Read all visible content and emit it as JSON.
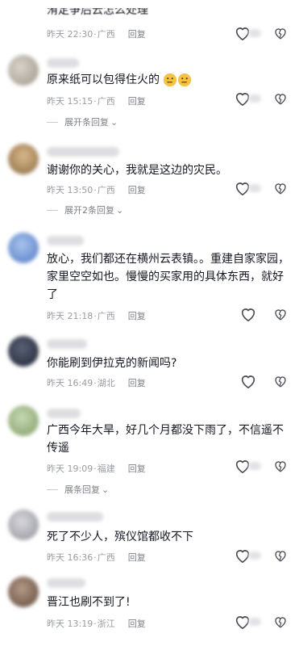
{
  "comments": [
    {
      "text": "洧定争后云怎么处理",
      "date": "昨天 22:30",
      "region": "广西",
      "reply": "回复"
    },
    {
      "text": "原来纸可以包得住火的",
      "date": "昨天 15:15",
      "region": "广西",
      "reply": "回复",
      "expand": "展开条回复"
    },
    {
      "text": "谢谢你的关心，我就是这边的灾民。",
      "date": "昨天 13:50",
      "region": "广西",
      "reply": "回复",
      "expand": "展开2条回复"
    },
    {
      "text": "放心，我们都还在横州云表镇。。重建自家家园，家里空空如也。慢慢的买家用的具体东西，就好了",
      "date": "昨天 21:18",
      "region": "广西",
      "reply": "回复"
    },
    {
      "text": "你能刷到伊拉克的新闻吗?",
      "date": "昨天 16:49",
      "region": "湖北",
      "reply": "回复"
    },
    {
      "text": "广西今年大旱，好几个月都没下雨了，不信遥不传遥",
      "date": "昨天 19:09",
      "region": "福建",
      "reply": "回复",
      "expand": "展条回复"
    },
    {
      "text": "死了不少人，殡仪馆都收不下",
      "date": "昨天 16:36",
      "region": "广西",
      "reply": "回复"
    },
    {
      "text": "晋江也刷不到了!",
      "date": "昨天 13:19",
      "region": "浙江",
      "reply": "回复"
    }
  ],
  "icons": {
    "like": "heart-icon",
    "dislike": "broken-heart-icon",
    "expand": "chevron-down-icon"
  },
  "colors": {
    "text": "#161823",
    "meta": "#9a9ca3",
    "reply": "#7f8188"
  }
}
